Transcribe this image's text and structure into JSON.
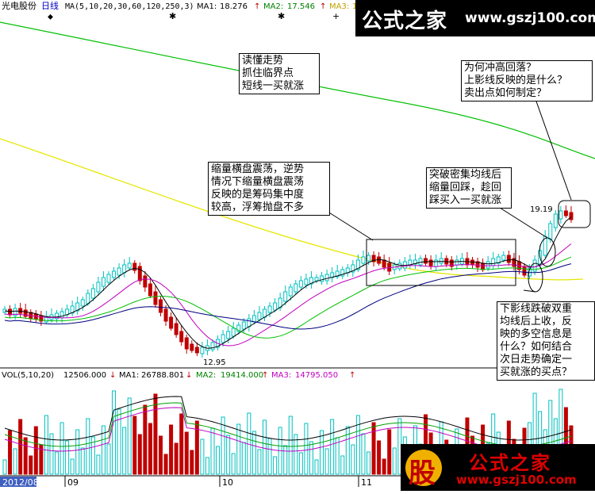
{
  "header": {
    "stock_name": "光电股份",
    "period": "日线",
    "ma_params": "MA(5,10,20,30,60,120,250,3)",
    "ma1_label": "MA1:",
    "ma1_value": "18.276",
    "ma2_label": "MA2:",
    "ma2_value": "17.546",
    "ma3_label": "MA3:",
    "ma3_value": "1"
  },
  "watermark": {
    "brand": "公式之家",
    "url": "www.gszj100.com",
    "brand2": "公式之家",
    "url2": "www.gszj100.com",
    "seal": "股"
  },
  "price_labels": {
    "high": "19.19",
    "low": "12.95"
  },
  "volume": {
    "params": "VOL(5,10,20)",
    "value": "12506.000",
    "ma1_label": "MA1:",
    "ma1_value": "26788.801",
    "ma2_label": "MA2:",
    "ma2_value": "19414.000",
    "ma3_label": "MA3:",
    "ma3_value": "14795.050"
  },
  "time_axis": {
    "label1": "2012/08",
    "label2": "09",
    "label3": "10",
    "label4": "11"
  },
  "annotations": {
    "a1": "读懂走势\n抓住临界点\n短线一买就涨",
    "a2": "为何冲高回落？\n上影线反映的是什么？\n卖出点如何制定？",
    "a3": "缩量横盘震荡，逆势\n情况下缩量横盘震荡\n反映的是筹码集中度\n较高，浮筹抛盘不多",
    "a4": "突破密集均线后\n缩量回踩，趁回\n踩买入一买就涨",
    "a5": "下影线跌破双重\n均线后上收，反\n映的多空信息是\n什么？如何结合\n次日走势确定一\n买就涨的买点？"
  },
  "colors": {
    "up": "#00c0c0",
    "down": "#c00000",
    "ma_green": "#00c000",
    "ma_yellow": "#e6e600",
    "ma_magenta": "#c000c0",
    "ma_black": "#000000",
    "header_blue": "#0000c0",
    "vol_up": "#00c0c0",
    "vol_down": "#c00000"
  }
}
